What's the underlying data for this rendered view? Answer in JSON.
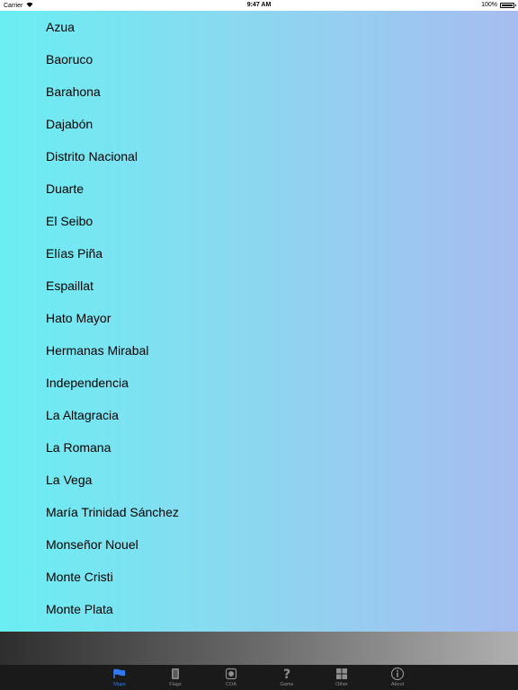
{
  "status": {
    "carrier": "Carrier",
    "time": "9:47 AM",
    "battery": "100%"
  },
  "provinces": [
    "Azua",
    "Baoruco",
    "Barahona",
    "Dajabón",
    "Distrito Nacional",
    "Duarte",
    "El Seibo",
    "Elías Piña",
    "Espaillat",
    "Hato Mayor",
    "Hermanas Mirabal",
    "Independencia",
    "La Altagracia",
    "La Romana",
    "La Vega",
    "María Trinidad Sánchez",
    "Monseñor Nouel",
    "Monte Cristi",
    "Monte Plata"
  ],
  "tabs": [
    {
      "label": "Maps",
      "icon": "flag-icon",
      "active": true
    },
    {
      "label": "Flags",
      "icon": "book-icon",
      "active": false
    },
    {
      "label": "COA",
      "icon": "emblem-icon",
      "active": false
    },
    {
      "label": "Game",
      "icon": "question-icon",
      "active": false
    },
    {
      "label": "Other",
      "icon": "grid-icon",
      "active": false
    },
    {
      "label": "About",
      "icon": "info-icon",
      "active": false
    }
  ],
  "colors": {
    "active_tab": "#2f7cf6",
    "inactive_tab": "#8e8e8e",
    "gradient_left": "#6aeef2",
    "gradient_right": "#a7bcf0"
  }
}
